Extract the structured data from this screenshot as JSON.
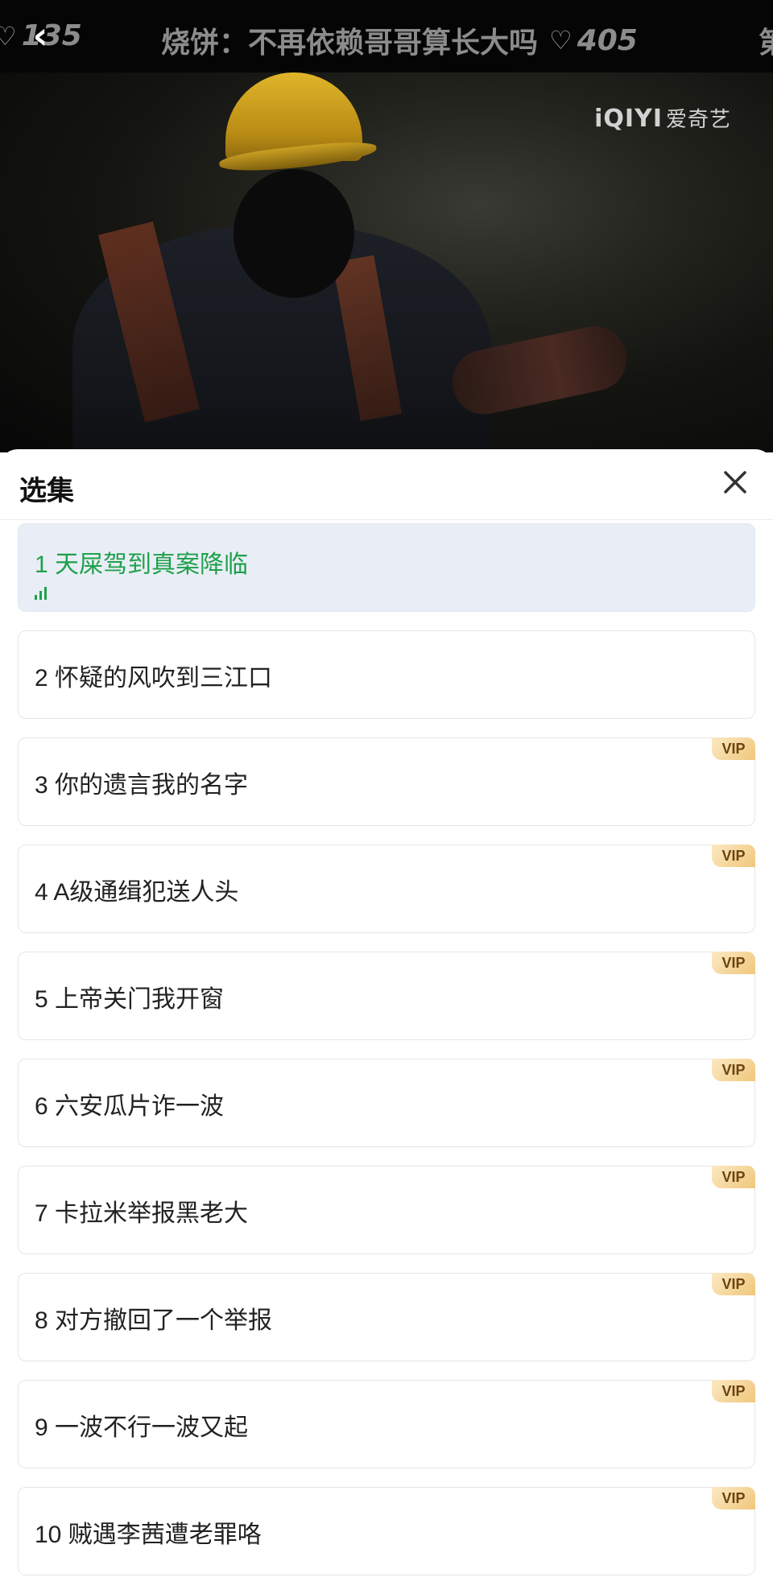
{
  "ticker": {
    "prev_count": "135",
    "next_title": "烧饼：不再依赖哥哥算长大吗",
    "next_count": "405",
    "edge_text": "第"
  },
  "video": {
    "watermark_brand": "iQIYI",
    "watermark_cn": "爱奇艺"
  },
  "sheet": {
    "title": "选集"
  },
  "episodes": [
    {
      "label": "1 天屎驾到真案降临",
      "vip": false,
      "active": true
    },
    {
      "label": "2 怀疑的风吹到三江口",
      "vip": false,
      "active": false
    },
    {
      "label": "3 你的遗言我的名字",
      "vip": true,
      "active": false
    },
    {
      "label": "4 A级通缉犯送人头",
      "vip": true,
      "active": false
    },
    {
      "label": "5 上帝关门我开窗",
      "vip": true,
      "active": false
    },
    {
      "label": "6 六安瓜片诈一波",
      "vip": true,
      "active": false
    },
    {
      "label": "7 卡拉米举报黑老大",
      "vip": true,
      "active": false
    },
    {
      "label": "8 对方撤回了一个举报",
      "vip": true,
      "active": false
    },
    {
      "label": "9 一波不行一波又起",
      "vip": true,
      "active": false
    },
    {
      "label": "10 贼遇李茜遭老罪咯",
      "vip": true,
      "active": false
    }
  ],
  "vip_label": "VIP",
  "colors": {
    "active_green": "#1ea04a",
    "active_bg": "#e9eef6",
    "vip_gold": "#f0c77b"
  }
}
